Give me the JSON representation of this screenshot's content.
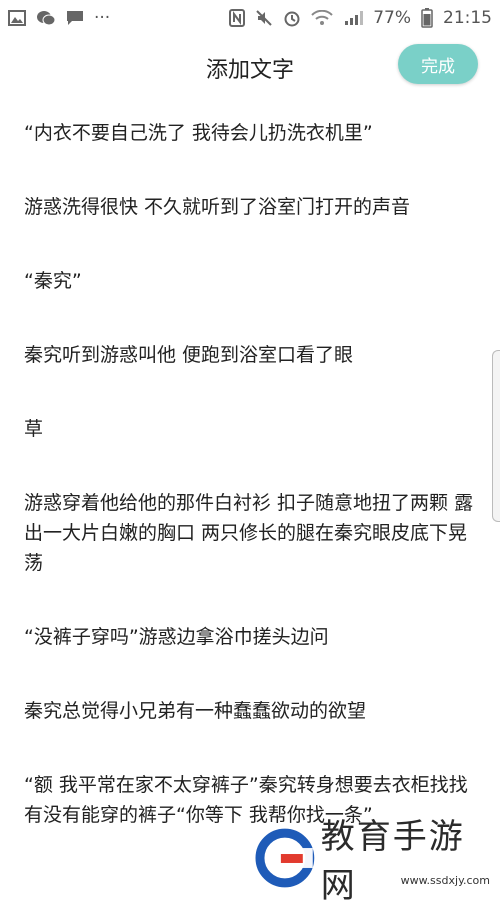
{
  "status_bar": {
    "left_icons": [
      "image-icon",
      "wechat-icon",
      "message-icon",
      "more-icon"
    ],
    "more_glyph": "···",
    "right_icons": [
      "nfc-icon",
      "mute-icon",
      "alarm-icon",
      "wifi-icon",
      "signal-icon",
      "battery-icon"
    ],
    "battery_percent": "77%",
    "time": "21:15"
  },
  "header": {
    "title": "添加文字",
    "done_label": "完成",
    "accent_color": "#7ad0c8"
  },
  "content": {
    "paragraphs": [
      "“内衣不要自己洗了 我待会儿扔洗衣机里”",
      "游惑洗得很快 不久就听到了浴室门打开的声音",
      "“秦究”",
      "秦究听到游惑叫他 便跑到浴室口看了眼",
      "草",
      "游惑穿着他给他的那件白衬衫  扣子随意地扭了两颗 露出一大片白嫩的胸口 两只修长的腿在秦究眼皮底下晃荡",
      "“没裤子穿吗”游惑边拿浴巾搓头边问",
      "秦究总觉得小兄弟有一种蠢蠢欲动的欲望",
      "“额 我平常在家不太穿裤子”秦究转身想要去衣柜找找有没有能穿的裤子“你等下 我帮你找一条”"
    ]
  },
  "watermark": {
    "text": "教育手游网",
    "url": "www.ssdxjy.com",
    "logo_color": "#1e5bb8",
    "logo_accent": "#e23a2e"
  }
}
